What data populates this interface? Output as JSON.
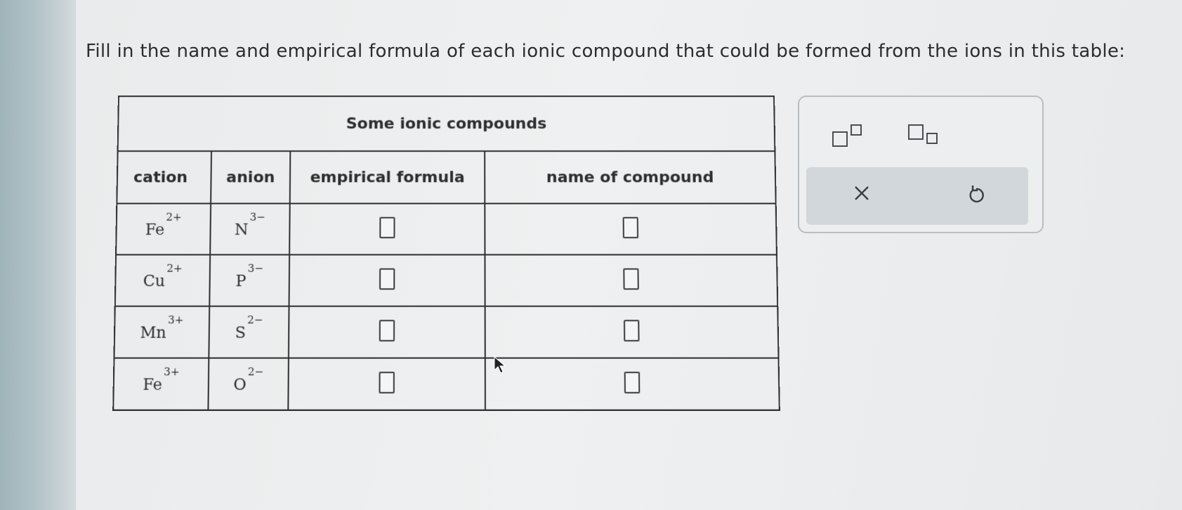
{
  "instruction": "Fill in the name and empirical formula of each ionic compound that could be formed from the ions in this table:",
  "table": {
    "title": "Some ionic compounds",
    "headers": {
      "cation": "cation",
      "anion": "anion",
      "formula": "empirical formula",
      "name": "name of compound"
    },
    "rows": [
      {
        "cation": "Fe",
        "cation_charge": "2+",
        "anion": "N",
        "anion_charge": "3−"
      },
      {
        "cation": "Cu",
        "cation_charge": "2+",
        "anion": "P",
        "anion_charge": "3−"
      },
      {
        "cation": "Mn",
        "cation_charge": "3+",
        "anion": "S",
        "anion_charge": "2−"
      },
      {
        "cation": "Fe",
        "cation_charge": "3+",
        "anion": "O",
        "anion_charge": "2−"
      }
    ]
  },
  "palette": {
    "superscript_icon": "superscript-box-icon",
    "subscript_icon": "subscript-box-icon",
    "clear_icon": "close-icon",
    "undo_icon": "undo-icon"
  },
  "colors": {
    "border": "#2e3033",
    "palette_bar": "#d2d7db",
    "palette_border": "#b9bec3"
  }
}
